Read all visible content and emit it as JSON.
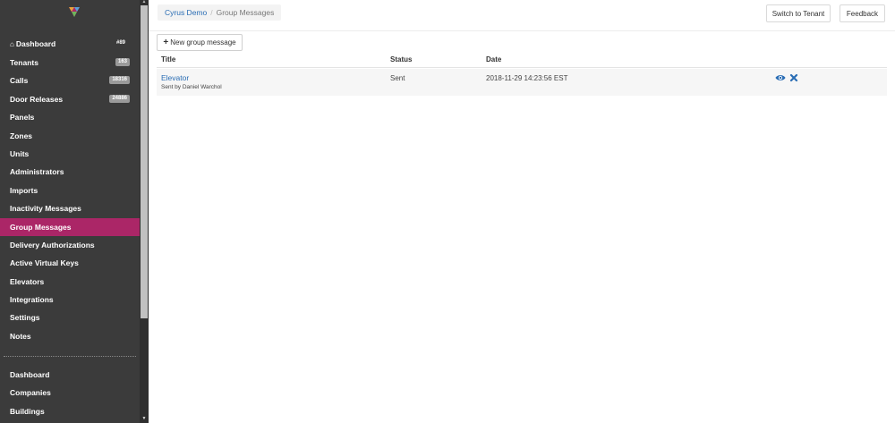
{
  "sidebar": {
    "items": [
      {
        "label": "Dashboard",
        "badge": "#89",
        "icon": "home-icon"
      },
      {
        "label": "Tenants",
        "badge": "163"
      },
      {
        "label": "Calls",
        "badge": "18316"
      },
      {
        "label": "Door Releases",
        "badge": "24886"
      },
      {
        "label": "Panels"
      },
      {
        "label": "Zones"
      },
      {
        "label": "Units"
      },
      {
        "label": "Administrators"
      },
      {
        "label": "Imports"
      },
      {
        "label": "Inactivity Messages"
      },
      {
        "label": "Group Messages"
      },
      {
        "label": "Delivery Authorizations"
      },
      {
        "label": "Active Virtual Keys"
      },
      {
        "label": "Elevators"
      },
      {
        "label": "Integrations"
      },
      {
        "label": "Settings"
      },
      {
        "label": "Notes"
      }
    ],
    "active_item": "Group Messages",
    "secondary_items": [
      {
        "label": "Dashboard"
      },
      {
        "label": "Companies"
      },
      {
        "label": "Buildings"
      }
    ]
  },
  "breadcrumb": {
    "parent": "Cyrus Demo",
    "separator": "/",
    "current": "Group Messages"
  },
  "topbar": {
    "switch_label": "Switch to Tenant",
    "feedback_label": "Feedback"
  },
  "main": {
    "new_button_label": "New group message",
    "columns": [
      "Title",
      "Status",
      "Date"
    ],
    "rows": [
      {
        "title": "Elevator",
        "subtitle": "Sent by Daniel Warchol",
        "status": "Sent",
        "date": "2018-11-29 14:23:56 EST"
      }
    ]
  },
  "colors": {
    "sidebar_bg": "#3b3b3b",
    "active_item": "#ab2667",
    "link": "#2a6db4"
  }
}
